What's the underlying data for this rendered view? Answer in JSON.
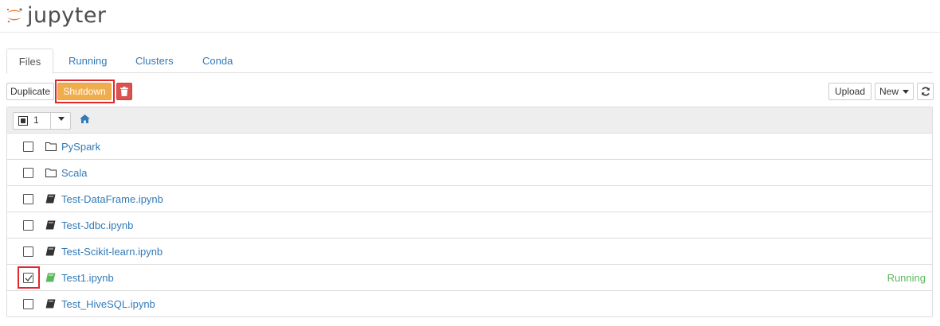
{
  "app": {
    "logo_text": "jupyter"
  },
  "tabs": [
    {
      "label": "Files",
      "active": true
    },
    {
      "label": "Running",
      "active": false
    },
    {
      "label": "Clusters",
      "active": false
    },
    {
      "label": "Conda",
      "active": false
    }
  ],
  "toolbar": {
    "duplicate_label": "Duplicate",
    "shutdown_label": "Shutdown",
    "delete_icon": "trash-icon",
    "upload_label": "Upload",
    "new_label": "New",
    "refresh_icon": "refresh-icon"
  },
  "list_header": {
    "selected_count": "1",
    "home_icon": "home-icon"
  },
  "items": [
    {
      "name": "PySpark",
      "type": "folder",
      "checked": false,
      "status": ""
    },
    {
      "name": "Scala",
      "type": "folder",
      "checked": false,
      "status": ""
    },
    {
      "name": "Test-DataFrame.ipynb",
      "type": "notebook",
      "checked": false,
      "status": ""
    },
    {
      "name": "Test-Jdbc.ipynb",
      "type": "notebook",
      "checked": false,
      "status": ""
    },
    {
      "name": "Test-Scikit-learn.ipynb",
      "type": "notebook",
      "checked": false,
      "status": ""
    },
    {
      "name": "Test1.ipynb",
      "type": "notebook",
      "checked": true,
      "status": "Running"
    },
    {
      "name": "Test_HiveSQL.ipynb",
      "type": "notebook",
      "checked": false,
      "status": ""
    }
  ],
  "colors": {
    "link": "#337ab7",
    "running": "#5cb85c",
    "shutdown": "#f0ad4e",
    "delete": "#d9534f",
    "highlight": "#e3262c",
    "logo_orange": "#f37726"
  }
}
